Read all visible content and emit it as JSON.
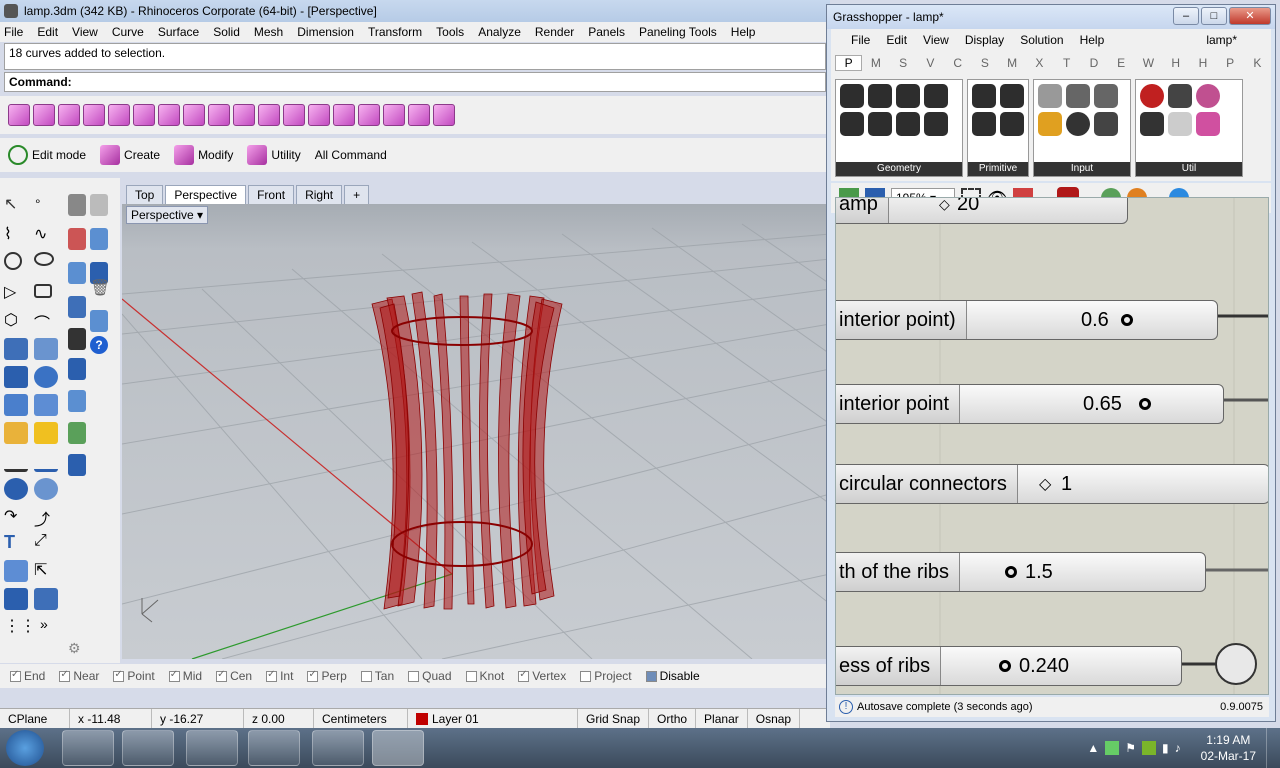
{
  "rhino": {
    "title": "lamp.3dm (342 KB) - Rhinoceros Corporate (64-bit) - [Perspective]",
    "menu": [
      "File",
      "Edit",
      "View",
      "Curve",
      "Surface",
      "Solid",
      "Mesh",
      "Dimension",
      "Transform",
      "Tools",
      "Analyze",
      "Render",
      "Panels",
      "Paneling Tools",
      "Help"
    ],
    "history": "18 curves added to selection.",
    "command_label": "Command:",
    "toolbar2": {
      "edit_mode": "Edit mode",
      "create": "Create",
      "modify": "Modify",
      "utility": "Utility",
      "all_command": "All Command"
    },
    "viewport_tabs": [
      "Top",
      "Perspective",
      "Front",
      "Right"
    ],
    "active_viewport_tab": "Perspective",
    "add_tab_glyph": "+",
    "viewport_label": "Perspective",
    "osnap": [
      {
        "label": "End",
        "checked": true
      },
      {
        "label": "Near",
        "checked": true
      },
      {
        "label": "Point",
        "checked": true
      },
      {
        "label": "Mid",
        "checked": true
      },
      {
        "label": "Cen",
        "checked": true
      },
      {
        "label": "Int",
        "checked": true
      },
      {
        "label": "Perp",
        "checked": true
      },
      {
        "label": "Tan",
        "checked": false
      },
      {
        "label": "Quad",
        "checked": false
      },
      {
        "label": "Knot",
        "checked": false
      },
      {
        "label": "Vertex",
        "checked": true
      },
      {
        "label": "Project",
        "checked": false
      },
      {
        "label": "Disable",
        "checked": false
      }
    ],
    "status": {
      "cplane": "CPlane",
      "x": "x -11.48",
      "y": "y -16.27",
      "z": "z 0.00",
      "units": "Centimeters",
      "layer": "Layer 01",
      "layer_color": "#c00000",
      "grid_snap": "Grid Snap",
      "ortho": "Ortho",
      "planar": "Planar",
      "osnap": "Osnap"
    }
  },
  "grasshopper": {
    "title": "Grasshopper - lamp*",
    "menu": [
      "File",
      "Edit",
      "View",
      "Display",
      "Solution",
      "Help"
    ],
    "doc_name": "lamp*",
    "tabs": [
      "P",
      "M",
      "S",
      "V",
      "C",
      "S",
      "M",
      "X",
      "T",
      "D",
      "E",
      "W",
      "H",
      "H",
      "P",
      "K"
    ],
    "component_panels": [
      "Geometry",
      "Primitive",
      "Input",
      "Util"
    ],
    "zoom": "195%",
    "sliders": [
      {
        "label": "amp",
        "value": "20",
        "kind": "diamond"
      },
      {
        "label": "interior point)",
        "value": "0.6",
        "kind": "circle"
      },
      {
        "label": "interior point",
        "value": "0.65",
        "kind": "circle"
      },
      {
        "label": "circular connectors",
        "value": "1",
        "kind": "diamond"
      },
      {
        "label": "th of the ribs",
        "value": "1.5",
        "kind": "circle"
      },
      {
        "label": "ess of ribs",
        "value": "0.240",
        "kind": "circle"
      }
    ],
    "status_msg": "Autosave complete (3 seconds ago)",
    "version": "0.9.0075"
  },
  "taskbar": {
    "time": "1:19 AM",
    "date": "02-Mar-17",
    "apps": [
      "explorer",
      "media-player",
      "chrome",
      "word",
      "muse",
      "rhino"
    ]
  }
}
